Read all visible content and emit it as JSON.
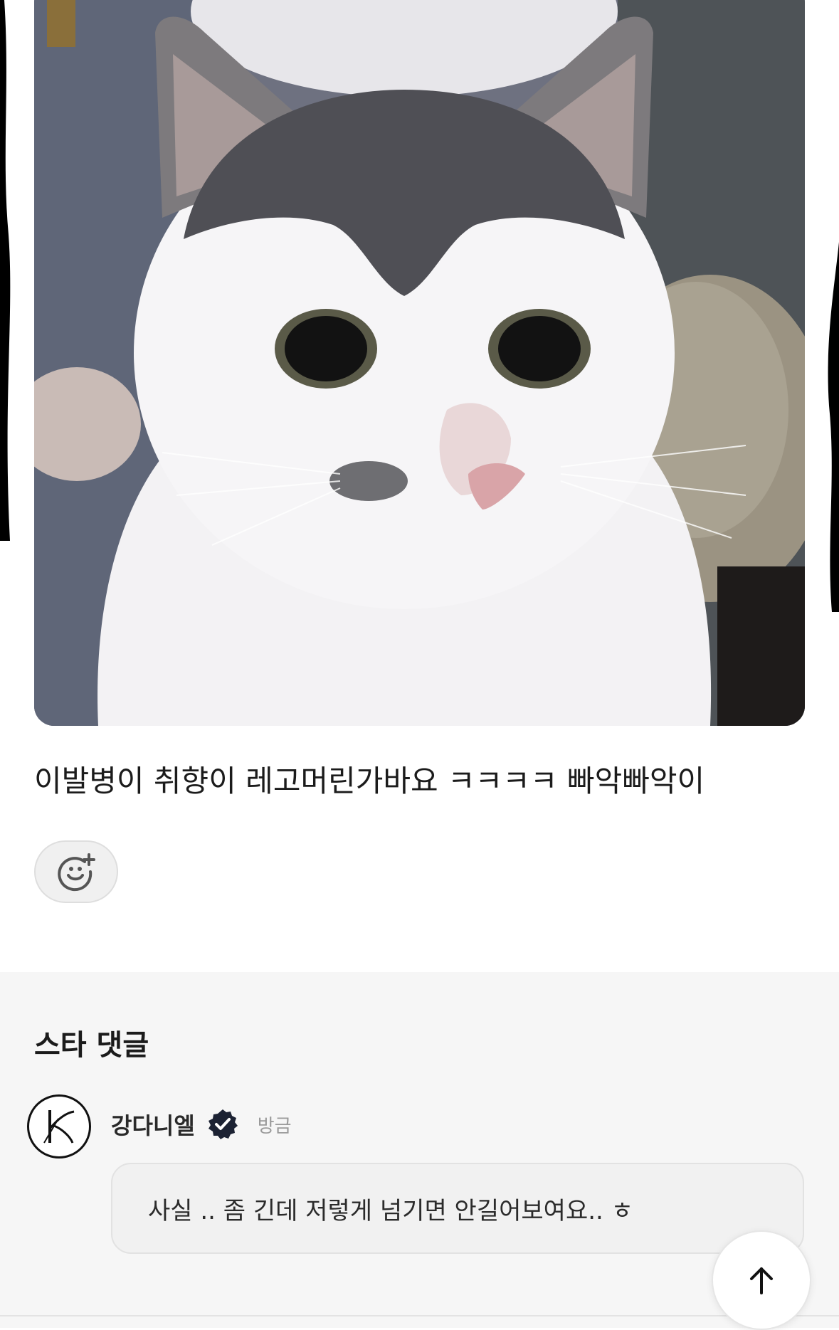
{
  "post": {
    "image_alt": "cat-photo",
    "caption": "이발병이 취향이 레고머린가바요 ㅋㅋㅋㅋ 빠악빠악이"
  },
  "reaction": {
    "icon": "add-reaction-icon"
  },
  "comments": {
    "section_title": "스타 댓글",
    "items": [
      {
        "author": "강다니엘",
        "verified": true,
        "time": "방금",
        "text": "사실 .. 좀 긴데 저렇게 넘기면 안길어보여요.. ㅎ",
        "avatar_icon": "k-monogram-logo"
      }
    ]
  },
  "scroll_top": {
    "icon": "arrow-up-icon"
  },
  "colors": {
    "background": "#ffffff",
    "comments_background": "#f6f6f6",
    "verified_badge": "#1c2233",
    "text": "#1b1b1b",
    "muted": "#9a9a9a"
  }
}
